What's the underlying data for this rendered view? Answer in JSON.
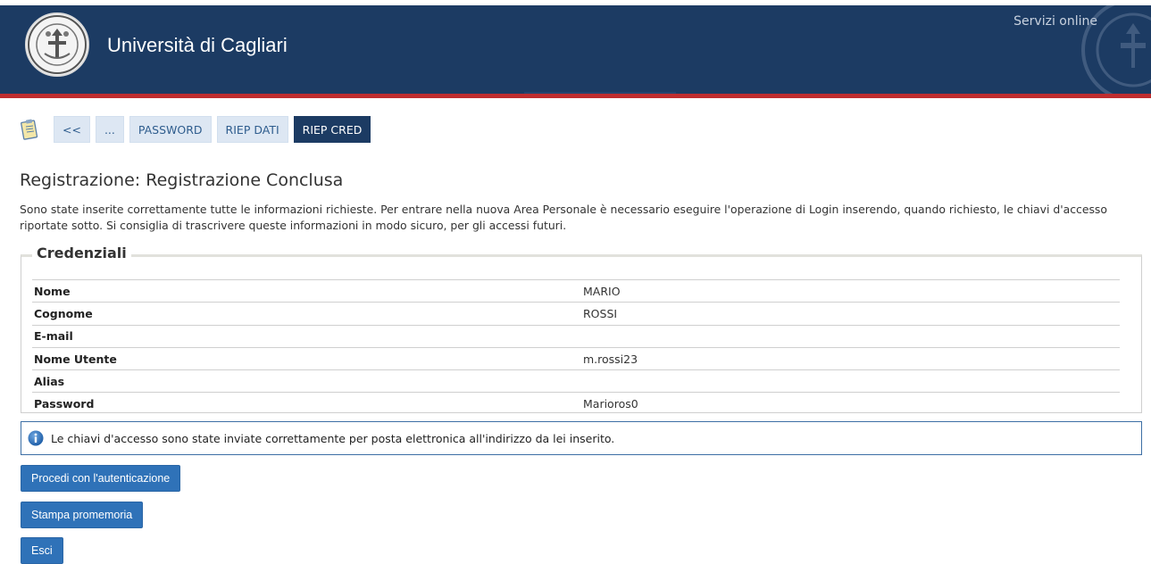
{
  "header": {
    "title": "Università di Cagliari",
    "services_link": "Servizi online",
    "background": "#1c3b63",
    "accent_bar": "#bf2d2f"
  },
  "steps": [
    {
      "label": "<<",
      "active": false
    },
    {
      "label": "...",
      "active": false
    },
    {
      "label": "PASSWORD",
      "active": false
    },
    {
      "label": "RIEP DATI",
      "active": false
    },
    {
      "label": "RIEP CRED",
      "active": true
    }
  ],
  "page": {
    "title": "Registrazione: Registrazione Conclusa",
    "intro": "Sono state inserite correttamente tutte le informazioni richieste. Per entrare nella nuova Area Personale è necessario eseguire l'operazione di Login inserendo, quando richiesto, le chiavi d'accesso riportate sotto. Si consiglia di trascrivere queste informazioni in modo sicuro, per gli accessi futuri."
  },
  "credentials": {
    "legend": "Credenziali",
    "rows": [
      {
        "label": "Nome",
        "value": "MARIO"
      },
      {
        "label": "Cognome",
        "value": "ROSSI"
      },
      {
        "label": "E-mail",
        "value": ""
      },
      {
        "label": "Nome Utente",
        "value": "m.rossi23"
      },
      {
        "label": "Alias",
        "value": ""
      },
      {
        "label": "Password",
        "value": "Marioros0"
      }
    ]
  },
  "info": {
    "icon": "info-icon",
    "message": "Le chiavi d'accesso sono state inviate correttamente per posta elettronica all'indirizzo da lei inserito."
  },
  "buttons": {
    "proceed": "Procedi con l'autenticazione",
    "print": "Stampa promemoria",
    "exit": "Esci"
  }
}
